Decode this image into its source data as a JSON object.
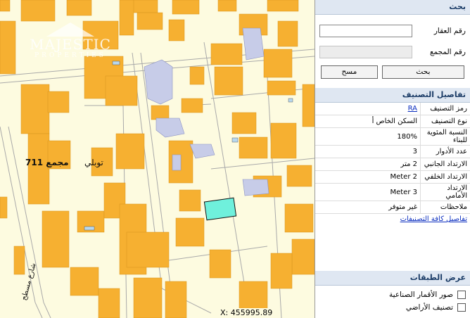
{
  "map": {
    "block_label": "مجمع 711",
    "area_label": "توبلي",
    "street_label": "شارع مسطح",
    "coord_label": "X: 455995.89",
    "logo": {
      "name": "MAJESTIC",
      "sub": "PROPERTIES"
    },
    "colors": {
      "background": "#fdfbe0",
      "building": "#f6b031",
      "public_building": "#c7cce8",
      "selected_parcel": "#6ff0dc",
      "road_line": "#a9a9a9"
    }
  },
  "panel": {
    "search": {
      "title": "بحث",
      "property_no_label": "رقم العقار",
      "property_no_value": "",
      "block_no_label": "رقم المجمع",
      "block_no_value": "",
      "search_button": "بحث",
      "clear_button": "مسح"
    },
    "details": {
      "title": "تفاصيل التصنيف",
      "rows": [
        {
          "key": "رمز التصنيف",
          "value": "RA",
          "link": true
        },
        {
          "key": "نوع التصنيف",
          "value": "السكن الخاص أ",
          "link": false
        },
        {
          "key": "النسبة المئوية للبناء",
          "value": "180%",
          "link": false
        },
        {
          "key": "عدد الأدوار",
          "value": "3",
          "link": false
        },
        {
          "key": "الارتداد الجانبي",
          "value": "2 متر",
          "link": false
        },
        {
          "key": "الارتداد الخلفي",
          "value": "Meter 2",
          "link": false
        },
        {
          "key": "الارتداد الأمامي",
          "value": "Meter 3",
          "link": false
        },
        {
          "key": "ملاحظات",
          "value": "غير متوفر",
          "link": false
        }
      ],
      "all_link": "تفاصيل كافة التصنيفات"
    },
    "layers": {
      "title": "عرض الطبقات",
      "items": [
        {
          "label": "صور الأقمار الصناعية",
          "checked": false
        },
        {
          "label": "تصنيف الأراضي",
          "checked": false
        }
      ]
    }
  }
}
